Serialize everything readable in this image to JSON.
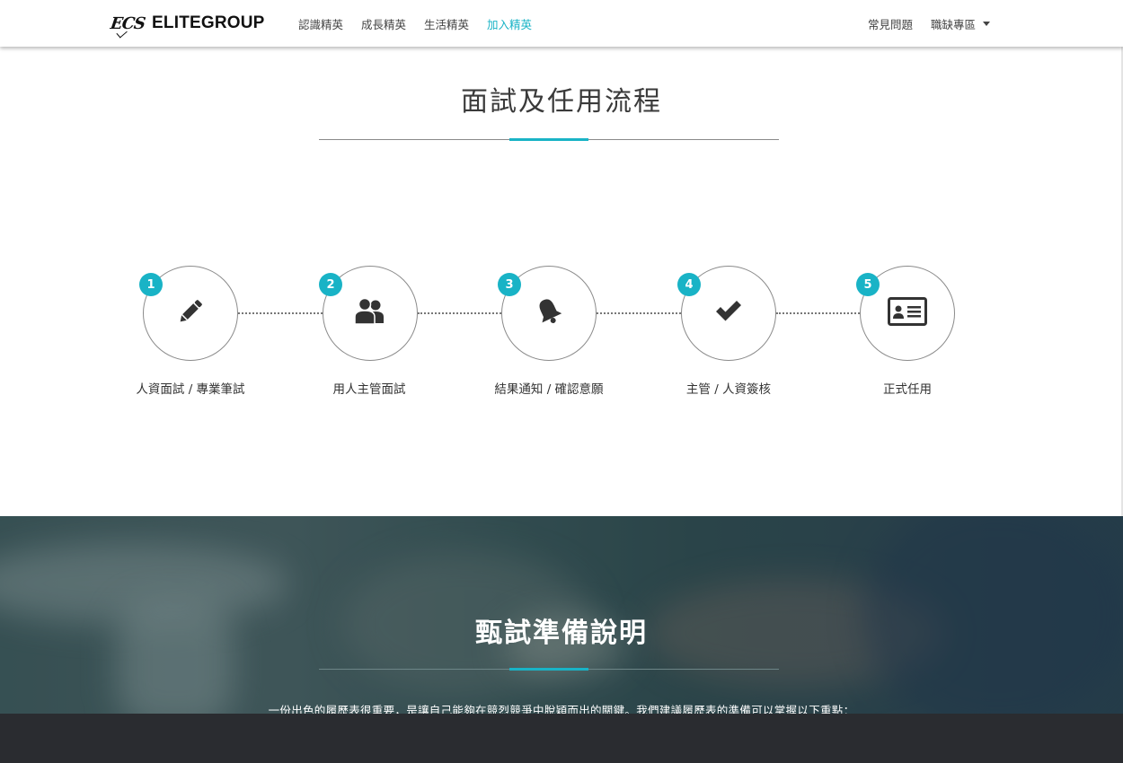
{
  "nav": {
    "logo_mark": "ECS",
    "logo_text": "ELITEGROUP",
    "left_items": [
      {
        "label": "認識精英",
        "active": false
      },
      {
        "label": "成長精英",
        "active": false
      },
      {
        "label": "生活精英",
        "active": false
      },
      {
        "label": "加入精英",
        "active": true
      }
    ],
    "faq": "常見問題",
    "jobs": "職缺專區"
  },
  "process": {
    "title": "面試及任用流程",
    "steps": [
      {
        "number": "1",
        "label": "人資面試 / 專業筆試",
        "icon": "pencil-icon"
      },
      {
        "number": "2",
        "label": "用人主管面試",
        "icon": "users-icon"
      },
      {
        "number": "3",
        "label": "結果通知 / 確認意願",
        "icon": "bell-icon"
      },
      {
        "number": "4",
        "label": "主管 / 人資簽核",
        "icon": "check-icon"
      },
      {
        "number": "5",
        "label": "正式任用",
        "icon": "id-card-icon"
      }
    ]
  },
  "prep": {
    "title": "甄試準備說明",
    "description": "一份出色的履歷表很重要，是讓自己能夠在競烈競爭中脫穎而出的關鍵。我們建議履歷表的準備可以掌握以下重點："
  },
  "colors": {
    "accent": "#19b3c6",
    "footer": "#2a2c30"
  }
}
